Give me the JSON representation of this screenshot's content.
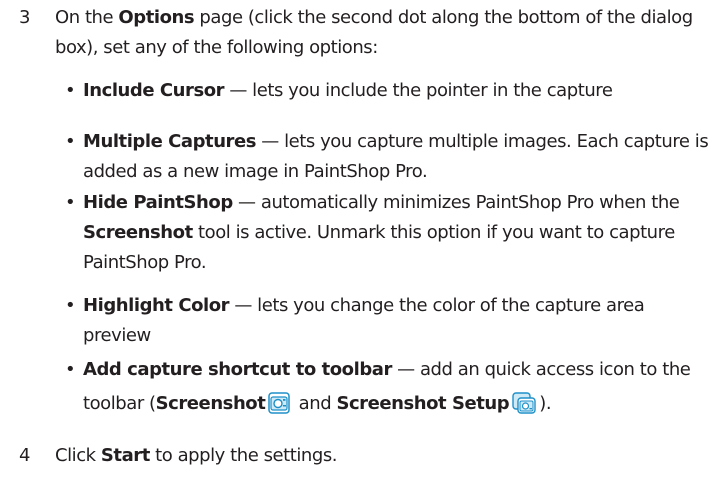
{
  "steps": [
    {
      "num": "3",
      "t1": "On the ",
      "b1": "Options",
      "t2": " page (click the second dot along the bottom of the dialog box), set any of the following options:"
    },
    {
      "num": "4",
      "t1": "Click ",
      "b1": "Start",
      "t2": " to apply the settings."
    }
  ],
  "bullet_char": "•",
  "options": [
    {
      "term": "Include Cursor",
      "desc": " — lets you include the pointer in the capture"
    },
    {
      "term": "Multiple Captures",
      "desc": " — lets you capture multiple images. Each capture is added as a new image in PaintShop Pro."
    },
    {
      "term": "Hide PaintShop",
      "desc_a": " — automatically minimizes PaintShop Pro when the ",
      "bold_b": "Screenshot",
      "desc_b": " tool is active. Unmark this option if you want to capture PaintShop Pro."
    },
    {
      "term": "Highlight Color",
      "desc": " — lets you change the color of the capture area preview"
    },
    {
      "term": "Add capture shortcut to toolbar",
      "desc_a": " — add an quick access icon to the toolbar (",
      "bold_b": "Screenshot",
      "icon_b": "camera-icon",
      "desc_c": " and ",
      "bold_d": "Screenshot Setup",
      "icon_d": "screenshot-setup-icon",
      "desc_e": ")."
    }
  ],
  "colors": {
    "text": "#231f20",
    "icon_blue": "#1e90c8",
    "icon_light": "#cfeaf7"
  }
}
